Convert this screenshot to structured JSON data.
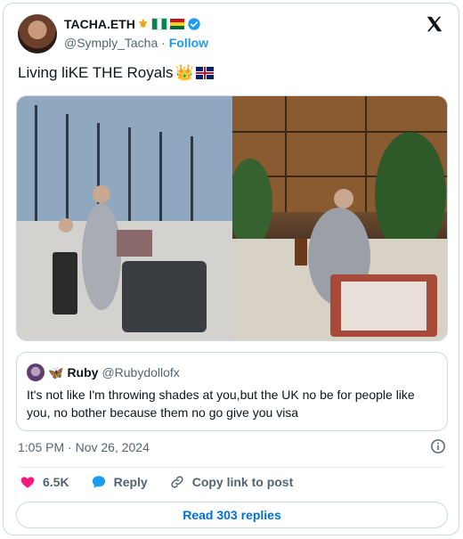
{
  "author": {
    "name": "TACHA.ETH",
    "handle": "@Symply_Tacha",
    "separator": "·",
    "follow_label": "Follow"
  },
  "tweet": {
    "text": "Living liKE THE Royals",
    "emoji_crown": "👑",
    "emoji_uk_flag": "🇬🇧"
  },
  "quoted": {
    "name": "Ruby",
    "handle": "@Rubydollofx",
    "text": "It's not like I'm throwing shades at you,but the UK no be for people like you, no bother because them no go give you visa"
  },
  "timestamp": "1:05 PM · Nov 26, 2024",
  "actions": {
    "likes": "6.5K",
    "reply_label": "Reply",
    "copy_label": "Copy link to post"
  },
  "read_replies_label": "Read 303 replies",
  "colors": {
    "accent": "#1d9bf0",
    "like": "#f91880",
    "link": "#006fd6"
  }
}
